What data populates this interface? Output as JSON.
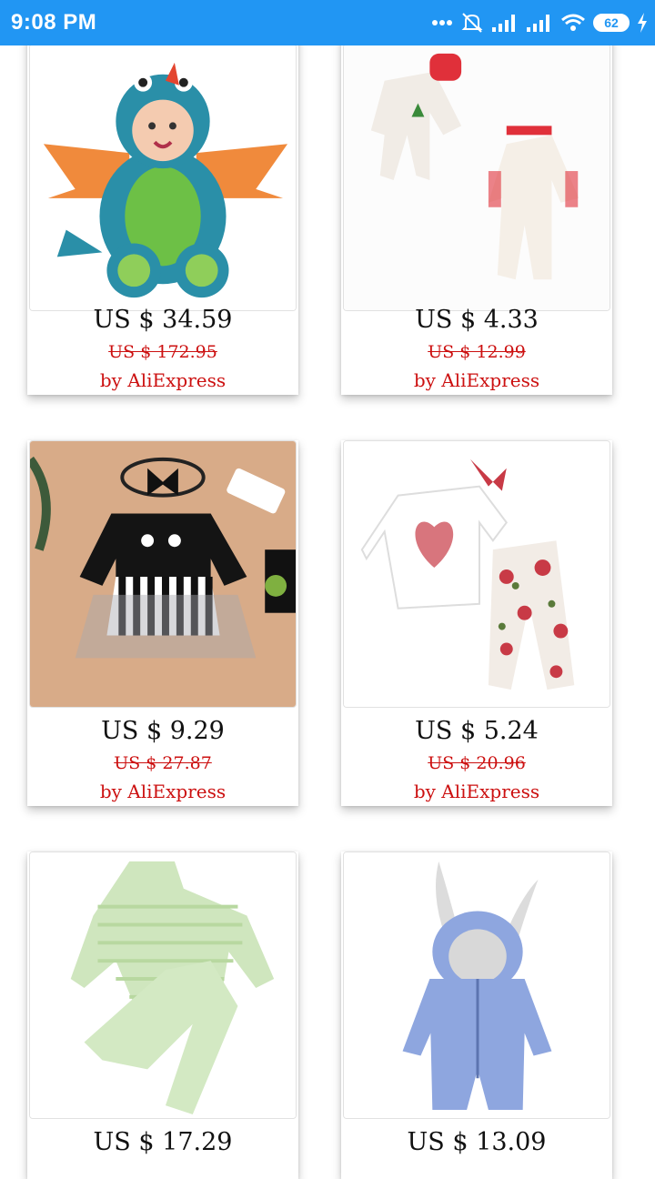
{
  "status_bar": {
    "time": "9:08 PM",
    "battery": "62"
  },
  "products": [
    {
      "price": "US $ 34.59",
      "old_price": "US $ 172.95",
      "seller": "by AliExpress",
      "image": "dragon-costume"
    },
    {
      "price": "US $ 4.33",
      "old_price": "US $ 12.99",
      "seller": "by AliExpress",
      "image": "christmas-rompers"
    },
    {
      "price": "US $ 9.29",
      "old_price": "US $ 27.87",
      "seller": "by AliExpress",
      "image": "halloween-tutu-romper"
    },
    {
      "price": "US $ 5.24",
      "old_price": "US $ 20.96",
      "seller": "by AliExpress",
      "image": "floral-heart-outfit"
    },
    {
      "price": "US $ 17.29",
      "image": "green-striped-set"
    },
    {
      "price": "US $ 13.09",
      "image": "blue-bunny-jumpsuit"
    }
  ]
}
